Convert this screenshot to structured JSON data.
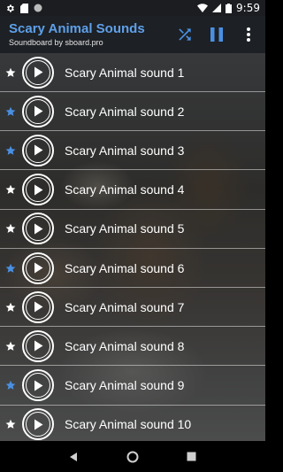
{
  "status_bar": {
    "time": "9:59",
    "left_icons": [
      "gear-icon",
      "sd-card-icon",
      "circle-icon"
    ],
    "right_icons": [
      "wifi-icon",
      "signal-icon",
      "battery-icon"
    ]
  },
  "app_bar": {
    "title": "Scary Animal Sounds",
    "subtitle": "Soundboard by sboard.pro",
    "actions": [
      "shuffle-icon",
      "pause-icon",
      "more-vert-icon"
    ],
    "title_color": "#5ea0ea"
  },
  "sounds": [
    {
      "label": "Scary Animal sound 1",
      "favorite": false
    },
    {
      "label": "Scary Animal sound 2",
      "favorite": true
    },
    {
      "label": "Scary Animal sound 3",
      "favorite": true
    },
    {
      "label": "Scary Animal sound 4",
      "favorite": false
    },
    {
      "label": "Scary Animal sound 5",
      "favorite": false
    },
    {
      "label": "Scary Animal sound 6",
      "favorite": true
    },
    {
      "label": "Scary Animal sound 7",
      "favorite": false
    },
    {
      "label": "Scary Animal sound 8",
      "favorite": false
    },
    {
      "label": "Scary Animal sound 9",
      "favorite": true
    },
    {
      "label": "Scary Animal sound 10",
      "favorite": false
    }
  ],
  "colors": {
    "star_favorite": "#4a90e2",
    "star_default": "#ffffff"
  },
  "nav_bar": [
    "back-icon",
    "home-icon",
    "recents-icon"
  ]
}
